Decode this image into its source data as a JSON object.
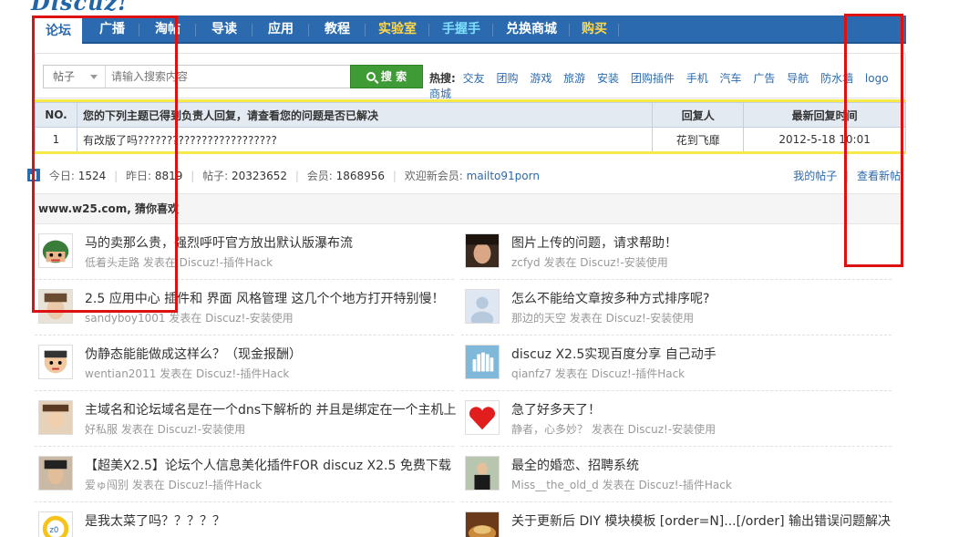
{
  "logo": "Discuz!",
  "nav": [
    {
      "label": "论坛",
      "style": "active"
    },
    {
      "label": "广播",
      "style": "normal"
    },
    {
      "label": "淘帖",
      "style": "normal"
    },
    {
      "label": "导读",
      "style": "normal"
    },
    {
      "label": "应用",
      "style": "normal"
    },
    {
      "label": "教程",
      "style": "normal"
    },
    {
      "label": "实验室",
      "style": "yellow"
    },
    {
      "label": "手握手",
      "style": "cyan"
    },
    {
      "label": "兑换商城",
      "style": "normal"
    },
    {
      "label": "购买",
      "style": "yellow"
    }
  ],
  "search": {
    "type": "帖子",
    "placeholder": "请输入搜索内容",
    "button": "搜 索",
    "hot_label": "热搜:",
    "hot_links": [
      "交友",
      "团购",
      "游戏",
      "旅游",
      "安装",
      "团购插件",
      "手机",
      "汽车",
      "广告",
      "导航",
      "防水墙",
      "logo",
      "商城"
    ]
  },
  "notice_table": {
    "headers": [
      "NO.",
      "您的下列主题已得到负责人回复，请查看您的问题是否已解决",
      "回复人",
      "最新回复时间"
    ],
    "rows": [
      {
        "no": "1",
        "title": "有改版了吗????????????????????????",
        "replier": "花到飞靡",
        "time": "2012-5-18 10:01"
      }
    ]
  },
  "stats": {
    "today_label": "今日:",
    "today": "1524",
    "yesterday_label": "昨日:",
    "yesterday": "8819",
    "posts_label": "帖子:",
    "posts": "20323652",
    "members_label": "会员:",
    "members": "1868956",
    "welcome_label": "欢迎新会员:",
    "newest": "mailto91porn",
    "my_posts": "我的帖子",
    "view_new": "查看新帖"
  },
  "guess_title": "www.w25.com, 猜你喜欢",
  "posts": [
    {
      "title": "马的卖那么贵，强烈呼吁官方放出默认版瀑布流",
      "user": "低着头走路",
      "forum": "发表在 Discuz!-插件Hack",
      "avatar": "cartoon-green"
    },
    {
      "title": "图片上传的问题，请求帮助！",
      "user": "zcfyd",
      "forum": "发表在 Discuz!-安装使用",
      "avatar": "portrait-girl"
    },
    {
      "title": "2.5 应用中心 插件和 界面 风格管理 这几个个地方打开特别慢！",
      "user": "sandyboy1001",
      "forum": "发表在 Discuz!-安装使用",
      "avatar": "portrait-light"
    },
    {
      "title": "怎么不能给文章按多种方式排序呢?",
      "user": "那边的天空",
      "forum": "发表在 Discuz!-安装使用",
      "avatar": "default"
    },
    {
      "title": "伪静态能能做成这样么？（现金报酬）",
      "user": "wentian2011",
      "forum": "发表在 Discuz!-插件Hack",
      "avatar": "cartoon-boy"
    },
    {
      "title": "discuz X2.5实现百度分享 自己动手",
      "user": "qianfz7",
      "forum": "发表在 Discuz!-插件Hack",
      "avatar": "hand"
    },
    {
      "title": "主域名和论坛域名是在一个dns下解析的 并且是绑定在一个主机上",
      "user": "好私服",
      "forum": "发表在 Discuz!-安装使用",
      "avatar": "portrait-woman"
    },
    {
      "title": "急了好多天了！",
      "user": "静者，心多妙？",
      "forum": "发表在 Discuz!-安装使用",
      "avatar": "heart"
    },
    {
      "title": "【超美X2.5】论坛个人信息美化插件FOR discuz X2.5 免费下载",
      "user": "爱ゅ闯别",
      "forum": "发表在 Discuz!-插件Hack",
      "avatar": "portrait-man"
    },
    {
      "title": "最全的婚恋、招聘系统",
      "user": "Miss__the_old_d",
      "forum": "发表在 Discuz!-插件Hack",
      "avatar": "portrait-suit"
    },
    {
      "title": "是我太菜了吗？？？？？",
      "user": "",
      "forum": "",
      "avatar": "logo-yellow"
    },
    {
      "title": "关于更新后 DIY 模块模板 [order=N]...[/order] 输出错误问题解决",
      "user": "",
      "forum": "",
      "avatar": "food"
    }
  ],
  "colors": {
    "nav_bg": "#2B6AAE",
    "highlight_yellow": "#FFD84A",
    "link_blue": "#2B6AAE",
    "annotation_red": "#DD1111"
  }
}
